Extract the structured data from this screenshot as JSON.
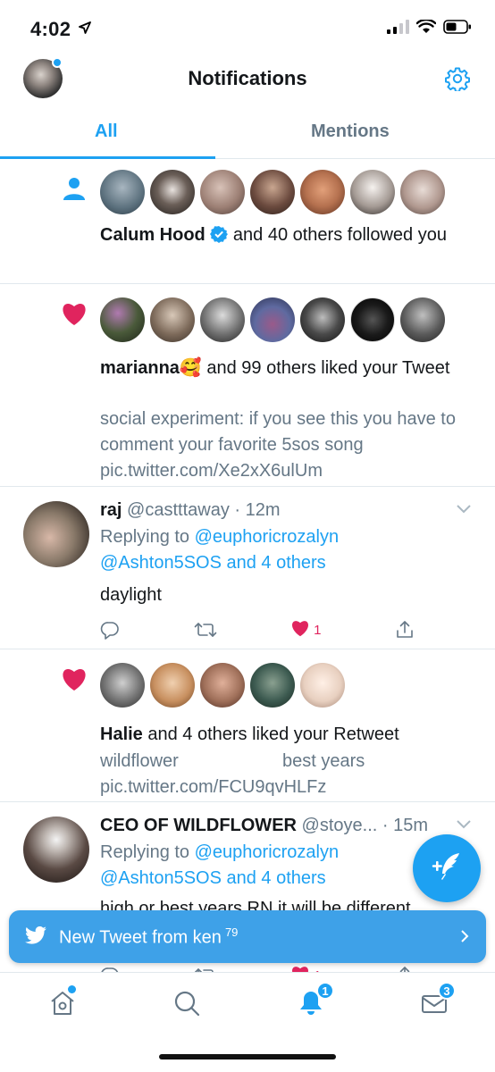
{
  "status_bar": {
    "time": "4:02"
  },
  "header": {
    "title": "Notifications"
  },
  "tabs": [
    {
      "label": "All"
    },
    {
      "label": "Mentions"
    }
  ],
  "notifications": [
    {
      "type": "follow",
      "actor": "Calum Hood",
      "verified": true,
      "rest": " and 40 others followed you",
      "avatar_colors": [
        "#5a6f7c",
        "#2e2a28",
        "#b89b8f",
        "#4a3b36",
        "#b5714f",
        "#efe8e4",
        "#c9b8b2"
      ]
    },
    {
      "type": "like",
      "actor": "marianna🥰",
      "rest": " and 99 others liked your Tweet",
      "quote": "social experiment: if you see this you have to comment your favorite 5sos song pic.twitter.com/Xe2xX6ulUm",
      "avatar_colors": [
        "#2f3b2a",
        "#7d6a5a",
        "#6f6f6f",
        "#5f6aa0",
        "#2a2a2a",
        "#111111",
        "#4a4a4a"
      ]
    },
    {
      "type": "reply",
      "name": "raj",
      "handle": "@castttaway",
      "time": "12m",
      "replying_to_label": "Replying to",
      "replying_to_user": "@euphoricrozalyn",
      "replying_to_more": "@Ashton5SOS and 4 others",
      "text": "daylight",
      "like_count": "1"
    },
    {
      "type": "like",
      "actor": "Halie",
      "rest": " and 4 others liked your Retweet",
      "quote_left": "wildflower",
      "quote_right": "best years",
      "quote_link": "pic.twitter.com/FCU9qvHLFz",
      "avatar_colors": [
        "#7a7a7a",
        "#c89060",
        "#a0705a",
        "#3c5a50",
        "#e8d0c0"
      ]
    },
    {
      "type": "reply",
      "name": "CEO OF WILDFLOWER",
      "handle": "@stoye...",
      "time": "15m",
      "replying_to_label": "Replying to",
      "replying_to_user": "@euphoricrozalyn",
      "replying_to_more": "@Ashton5SOS and 4 others",
      "text": "high or best years RN it will be different",
      "like_count": "1"
    }
  ],
  "toast": {
    "text": "New Tweet from ken",
    "superscript": "79"
  },
  "tabbar": {
    "notifications_badge": "1",
    "messages_badge": "3"
  },
  "colors": {
    "accent": "#1da1f2",
    "like": "#e0245e",
    "secondary_text": "#657786"
  }
}
